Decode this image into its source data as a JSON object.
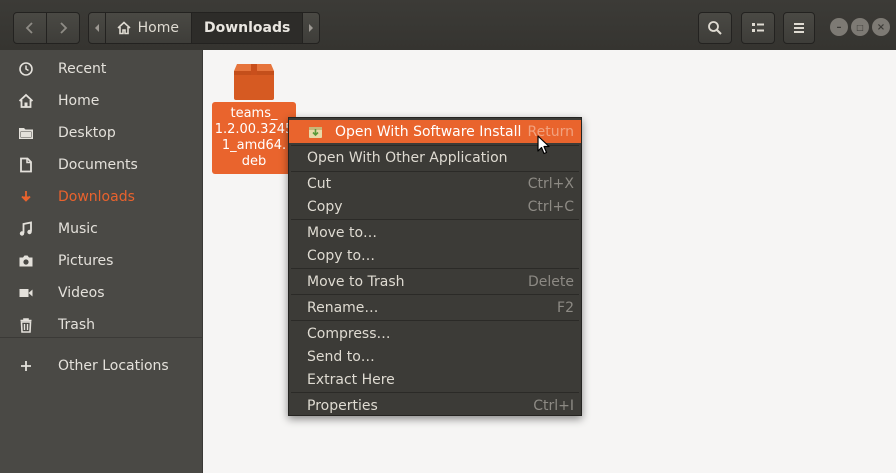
{
  "header": {
    "back_icon": "chevron-left-icon",
    "forward_icon": "chevron-right-icon",
    "breadcrumb": [
      {
        "label": "Home",
        "icon": "home-icon"
      },
      {
        "label": "Downloads"
      }
    ],
    "search_icon": "search-icon",
    "view_icon": "grid-view-icon",
    "menu_icon": "hamburger-menu-icon",
    "window_controls": [
      "minimize",
      "maximize",
      "close"
    ]
  },
  "sidebar": {
    "items": [
      {
        "label": "Recent",
        "icon": "clock-icon"
      },
      {
        "label": "Home",
        "icon": "home-icon"
      },
      {
        "label": "Desktop",
        "icon": "folder-icon"
      },
      {
        "label": "Documents",
        "icon": "document-icon"
      },
      {
        "label": "Downloads",
        "icon": "download-icon",
        "active": true
      },
      {
        "label": "Music",
        "icon": "music-icon"
      },
      {
        "label": "Pictures",
        "icon": "camera-icon"
      },
      {
        "label": "Videos",
        "icon": "video-icon"
      },
      {
        "label": "Trash",
        "icon": "trash-icon"
      },
      {
        "label": "Other Locations",
        "icon": "plus-icon"
      }
    ]
  },
  "files": [
    {
      "name_lines": "teams_\n1.2.00.3245\n1_amd64.\ndeb",
      "icon": "package-icon",
      "selected": true
    }
  ],
  "context_menu": {
    "items": [
      {
        "label": "Open With Software Install",
        "accel": "Return",
        "highlighted": true,
        "icon": "software-install-icon"
      },
      {
        "label": "Open With Other Application",
        "accel": ""
      },
      {
        "label": "Cut",
        "accel": "Ctrl+X"
      },
      {
        "label": "Copy",
        "accel": "Ctrl+C"
      },
      {
        "label": "Move to…",
        "accel": ""
      },
      {
        "label": "Copy to…",
        "accel": ""
      },
      {
        "label": "Move to Trash",
        "accel": "Delete"
      },
      {
        "label": "Rename…",
        "accel": "F2"
      },
      {
        "label": "Compress…",
        "accel": ""
      },
      {
        "label": "Send to…",
        "accel": ""
      },
      {
        "label": "Extract Here",
        "accel": ""
      },
      {
        "label": "Properties",
        "accel": "Ctrl+I"
      }
    ]
  },
  "colors": {
    "accent": "#e9642d",
    "headerbar": "#3c3b37",
    "sidebar": "#4a4945",
    "menu": "#3c3b37"
  }
}
